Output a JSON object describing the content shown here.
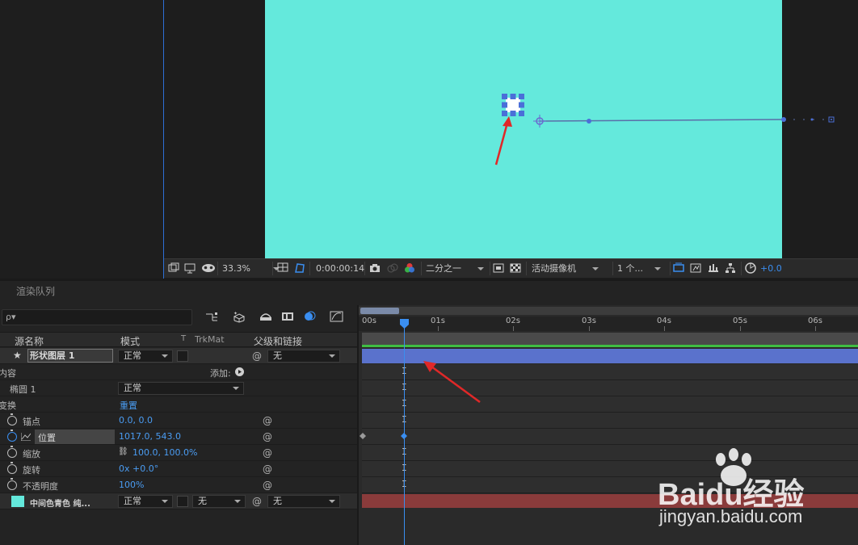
{
  "viewer": {
    "zoom": "33.3%",
    "timecode": "0:00:00:14",
    "resolution": "二分之一",
    "camera": "活动摄像机",
    "views": "1 个...",
    "exposure": "+0.0"
  },
  "panels": {
    "render_queue_tab": "渲染队列"
  },
  "timeline": {
    "search_placeholder": "ρ▾",
    "columns": {
      "source_name": "源名称",
      "mode": "模式",
      "t": "T",
      "trkmat": "TrkMat",
      "parent": "父级和链接"
    },
    "ruler_labels": [
      "00s",
      "01s",
      "02s",
      "03s",
      "04s",
      "05s",
      "06s"
    ],
    "layers": {
      "shape_layer": {
        "name": "形状图层 1",
        "mode": "正常",
        "parent": "无"
      },
      "contents": {
        "label": "内容",
        "add_label": "添加:"
      },
      "ellipse": {
        "label": "椭圆 1",
        "mode": "正常"
      },
      "transform": {
        "label": "变换",
        "reset": "重置"
      },
      "properties": [
        {
          "name": "锚点",
          "value": "0.0, 0.0"
        },
        {
          "name": "位置",
          "value": "1017.0, 543.0"
        },
        {
          "name": "缩放",
          "value": "100.0, 100.0%"
        },
        {
          "name": "旋转",
          "value": "0x +0.0°"
        },
        {
          "name": "不透明度",
          "value": "100%"
        }
      ],
      "solid_layer": {
        "name": "中间色青色 纯...",
        "mode": "正常",
        "trkmat": "无",
        "parent": "无"
      }
    }
  },
  "watermark": {
    "brand": "Baidu经验",
    "url": "jingyan.baidu.com"
  },
  "colors": {
    "canvas": "#64e9dc",
    "accent": "#3a8ef0",
    "shape_bar": "#5a72cc",
    "solid_bar": "#8a3b3b",
    "arrow": "#e02828"
  }
}
